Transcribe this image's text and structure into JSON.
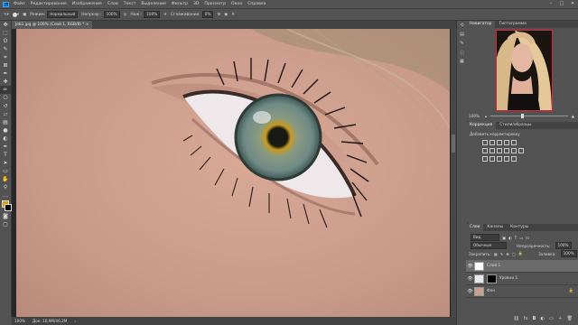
{
  "menu": {
    "logo": "Ps",
    "items": [
      "Файл",
      "Редактирование",
      "Изображение",
      "Слои",
      "Текст",
      "Выделение",
      "Фильтр",
      "3D",
      "Просмотр",
      "Окно",
      "Справка"
    ]
  },
  "options": {
    "mode_label": "Режим:",
    "mode_value": "Нормальный",
    "opacity_label": "Непрозр.:",
    "opacity_value": "100%",
    "flow_label": "Наж.:",
    "flow_value": "100%",
    "smooth_label": "Сглаживание:",
    "smooth_value": "0%"
  },
  "document": {
    "tab_title": "Jeb1.jpg @ 100% (Слой 1, RGB/8) *",
    "zoom": "100%",
    "doc_info": "Док: 10,9M/46,2M"
  },
  "navigator": {
    "tabs": [
      "Навигатор",
      "Гистограмма"
    ],
    "zoom": "100%"
  },
  "adjustments": {
    "tabs": [
      "Коррекция",
      "Стили/образцы"
    ],
    "caption": "Добавить корректировку"
  },
  "layers": {
    "tabs": [
      "Слои",
      "Каналы",
      "Контуры"
    ],
    "filter_value": "Вид",
    "blend_value": "Обычные",
    "opacity_label": "Непрозрачность:",
    "opacity_value": "100%",
    "lock_label": "Закрепить:",
    "fill_label": "Заливка:",
    "fill_value": "100%",
    "rows": [
      {
        "name": "Слой 1"
      },
      {
        "name": "Уровни 1"
      },
      {
        "name": "Фон"
      }
    ]
  },
  "colors": {
    "accent": "#31a8ff",
    "selection": "#d23333"
  }
}
